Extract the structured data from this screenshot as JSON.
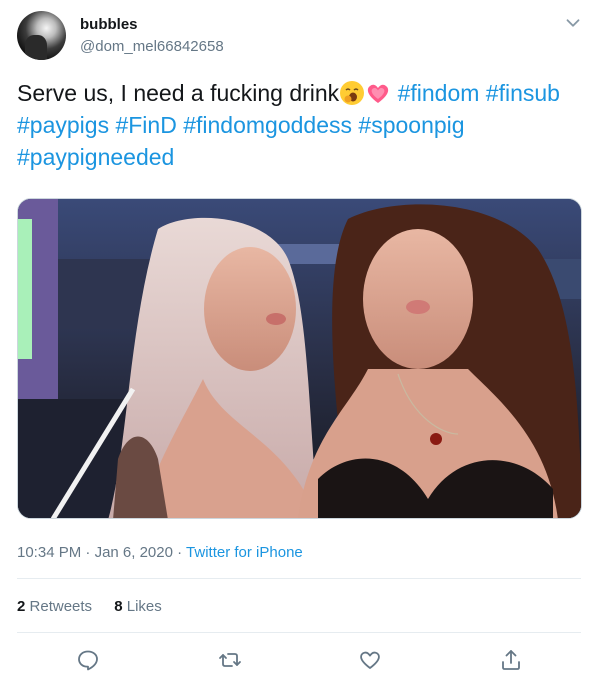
{
  "author": {
    "display_name": "bubbles",
    "handle": "@dom_mel66842658"
  },
  "tweet": {
    "text_before": "Serve us, I need a fucking drink",
    "hashtags": [
      "#findom",
      "#finsub",
      "#paypigs",
      "#FinD",
      "#findomgoddess",
      "#spoonpig",
      "#paypigneeded"
    ],
    "emojis": [
      "yawning-face-emoji",
      "sparkling-heart-emoji"
    ]
  },
  "meta": {
    "time": "10:34 PM",
    "date": "Jan 6, 2020",
    "separator": "·",
    "source": "Twitter for iPhone"
  },
  "stats": {
    "retweets_count": "2",
    "retweets_label": "Retweets",
    "likes_count": "8",
    "likes_label": "Likes"
  },
  "actions": [
    "reply-icon",
    "retweet-icon",
    "like-icon",
    "share-icon"
  ],
  "colors": {
    "link": "#1b95e0",
    "text": "#14171a",
    "secondary": "#657786",
    "divider": "#e6ecf0"
  }
}
